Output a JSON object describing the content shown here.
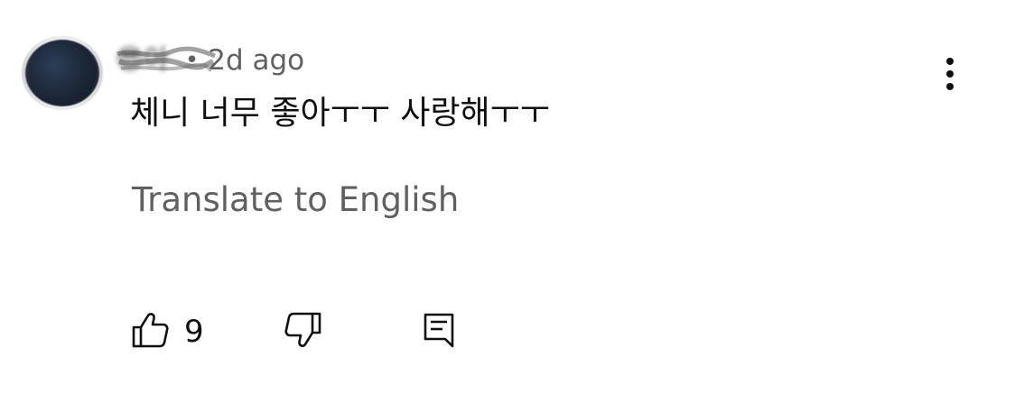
{
  "comment": {
    "author": "😎아",
    "separator": "•",
    "timestamp": "2d ago",
    "text": "체니 너무 좋아ㅜㅜ 사랑해ㅜㅜ",
    "translate_label": "Translate to English",
    "like_count": "9",
    "avatar_color": "#1b2535",
    "icons": {
      "more": "more-vert-icon",
      "like": "thumbs-up-icon",
      "dislike": "thumbs-down-icon",
      "reply": "reply-comment-icon"
    },
    "colors": {
      "text": "#0f0f0f",
      "secondary": "#606060",
      "background": "#ffffff"
    }
  }
}
